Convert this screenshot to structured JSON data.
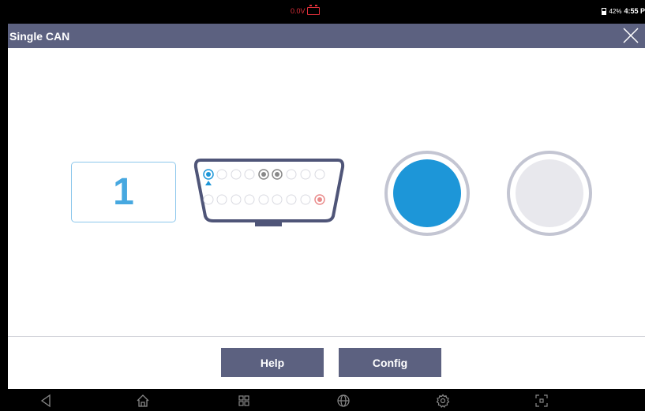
{
  "status_bar": {
    "voltage": "0.0V",
    "battery_percent": "42%",
    "time": "4:55 P"
  },
  "header": {
    "title": "Single CAN"
  },
  "main": {
    "channel_number": "1",
    "status_indicators": [
      {
        "state": "active",
        "color": "#1d96d8"
      },
      {
        "state": "inactive",
        "color": "#e8e8ed"
      }
    ]
  },
  "footer": {
    "help_label": "Help",
    "config_label": "Config"
  },
  "nav": {
    "icons": [
      "back-icon",
      "home-icon",
      "apps-icon",
      "browser-icon",
      "settings-icon",
      "screenshot-icon"
    ]
  },
  "colors": {
    "header_bg": "#5c6180",
    "accent_blue": "#1d96d8",
    "voltage_red": "#e0303a"
  }
}
